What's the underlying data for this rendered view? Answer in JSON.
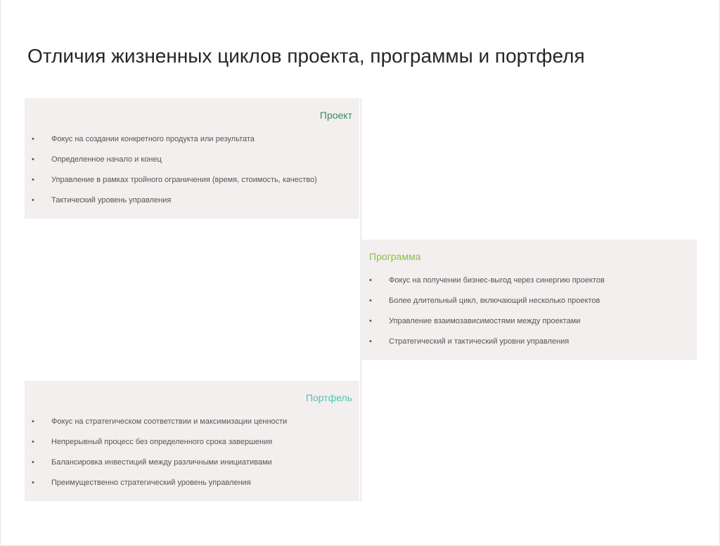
{
  "title": "Отличия жизненных циклов проекта, программы и портфеля",
  "colors": {
    "project_heading": "#3a8a6a",
    "program_heading": "#8cc04a",
    "portfolio_heading": "#5ac0b4",
    "card_background": "#f2efee"
  },
  "cards": [
    {
      "heading": "Проект",
      "items": [
        "Фокус на создании конкретного продукта или результата",
        "Определенное начало и конец",
        "Управление в рамках тройного ограничения (время, стоимость, качество)",
        "Тактический уровень управления"
      ]
    },
    {
      "heading": "Программа",
      "items": [
        "Фокус на получении бизнес-выгод через синергию проектов",
        "Более длительный цикл, включающий несколько проектов",
        "Управление взаимозависимостями между проектами",
        "Стратегический и тактический уровни управления"
      ]
    },
    {
      "heading": "Портфель",
      "items": [
        "Фокус на стратегическом соответствии и максимизации ценности",
        "Непрерывный процесс без определенного срока завершения",
        "Балансировка инвестиций между различными инициативами",
        "Преимущественно стратегический уровень управления"
      ]
    }
  ],
  "bullet": "•"
}
